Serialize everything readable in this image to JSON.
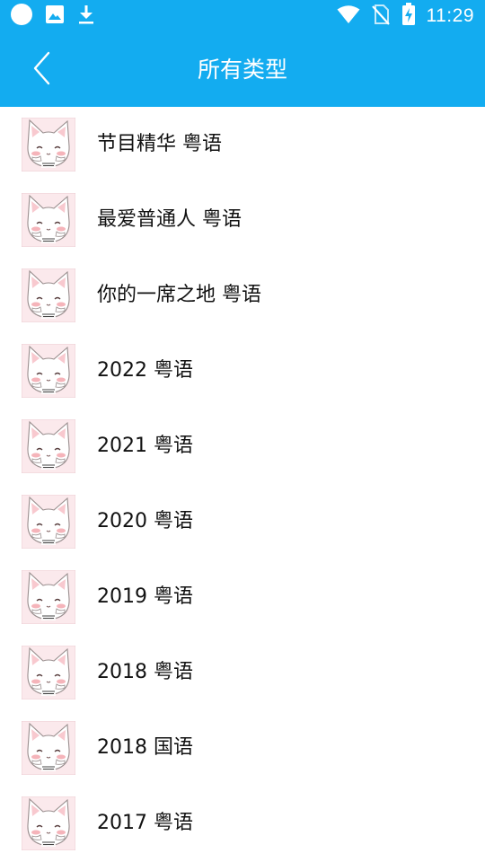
{
  "status_bar": {
    "time": "11:29",
    "left_icons": [
      "circle-icon",
      "image-icon",
      "download-icon"
    ],
    "right_icons": [
      "wifi-icon",
      "no-sim-icon",
      "battery-charging-icon"
    ]
  },
  "header": {
    "title": "所有类型",
    "back_icon": "chevron-left-icon",
    "background": "#13ACF0"
  },
  "list": {
    "items": [
      {
        "label": "节目精华 粤语"
      },
      {
        "label": "最爱普通人 粤语"
      },
      {
        "label": "你的一席之地 粤语"
      },
      {
        "label": "2022 粤语"
      },
      {
        "label": "2021 粤语"
      },
      {
        "label": "2020 粤语"
      },
      {
        "label": "2019 粤语"
      },
      {
        "label": "2018 粤语"
      },
      {
        "label": "2018 国语"
      },
      {
        "label": "2017 粤语"
      }
    ]
  }
}
